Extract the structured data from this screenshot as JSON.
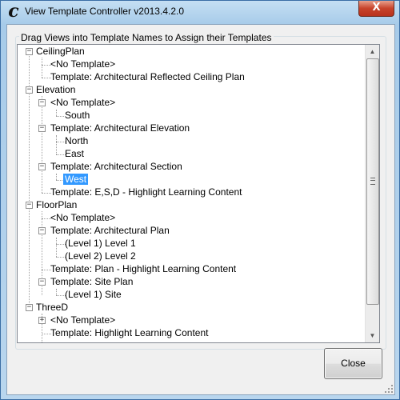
{
  "window": {
    "title": "View Template Controller v2013.4.2.0",
    "app_icon": "c",
    "close_symbol": "X"
  },
  "groupbox": {
    "label": "Drag Views into Template Names to Assign their Templates"
  },
  "tree": {
    "rows": [
      {
        "text": "CeilingPlan"
      },
      {
        "text": "<No Template>"
      },
      {
        "text": "Template: Architectural Reflected Ceiling Plan"
      },
      {
        "text": "Elevation"
      },
      {
        "text": "<No Template>"
      },
      {
        "text": "South"
      },
      {
        "text": "Template: Architectural Elevation"
      },
      {
        "text": "North"
      },
      {
        "text": "East"
      },
      {
        "text": "Template: Architectural Section"
      },
      {
        "text": "West",
        "selected": true
      },
      {
        "text": "Template: E,S,D - Highlight Learning Content"
      },
      {
        "text": "FloorPlan"
      },
      {
        "text": "<No Template>"
      },
      {
        "text": "Template: Architectural Plan"
      },
      {
        "text": "(Level 1) Level 1"
      },
      {
        "text": "(Level 2) Level 2"
      },
      {
        "text": "Template: Plan - Highlight Learning Content"
      },
      {
        "text": "Template: Site Plan"
      },
      {
        "text": "(Level 1) Site"
      },
      {
        "text": "ThreeD"
      },
      {
        "text": "<No Template>"
      },
      {
        "text": "Template: Highlight Learning Content"
      }
    ]
  },
  "buttons": {
    "close_label": "Close"
  }
}
